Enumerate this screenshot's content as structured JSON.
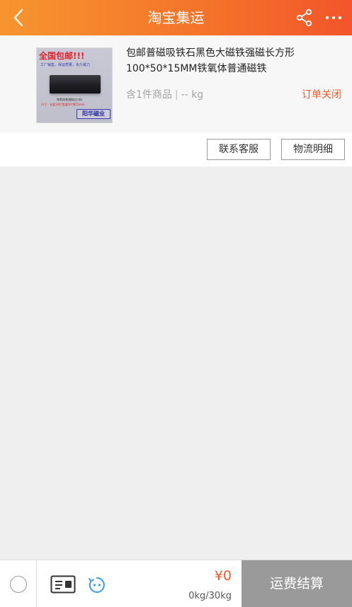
{
  "header": {
    "title": "淘宝集运",
    "back_icon": "chevron-left-icon",
    "share_icon": "share-icon",
    "more_icon": "more-dots-icon"
  },
  "product": {
    "title": "包邮普磁吸铁石黑色大磁铁强磁长方形100*50*15MM铁氧体普通磁铁",
    "count_text": "含1件商品",
    "weight_text": "-- kg",
    "status": "订单关闭",
    "image": {
      "banner": "全国包邮!!!",
      "line1": "工厂销售，保证质量，永久磁力",
      "line2": "铁氧体普通磁出口料",
      "line3": "尺寸：长度100*宽度50*厚15mm",
      "stamp": "阳华磁业"
    }
  },
  "actions": {
    "contact_label": "联系客服",
    "logistics_label": "物流明细"
  },
  "bottom": {
    "price": "¥0",
    "weight": "0kg/30kg",
    "checkout_label": "运费结算"
  },
  "colors": {
    "accent": "#f0582a",
    "header_start": "#f7952f",
    "header_end": "#f2552a",
    "checkout_bg": "#9a9a9a"
  }
}
